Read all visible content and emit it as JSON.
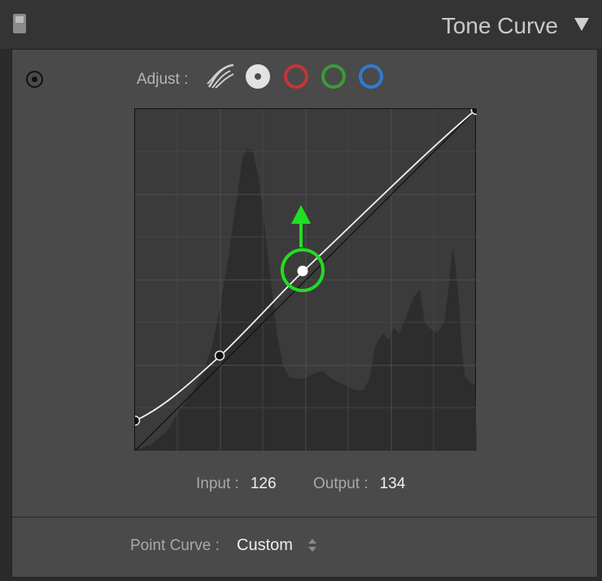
{
  "header": {
    "title": "Tone Curve",
    "panel_toggle_icon": "panel-switch-icon",
    "collapse_icon": "triangle-down-icon"
  },
  "adjust": {
    "label": "Adjust :",
    "channels": [
      {
        "name": "region",
        "icon": "region-curve-icon"
      },
      {
        "name": "point",
        "icon": "point-curve-icon",
        "selected": true
      },
      {
        "name": "red",
        "color": "#c4343a"
      },
      {
        "name": "green",
        "color": "#3a9a3a"
      },
      {
        "name": "blue",
        "color": "#2f7bd3"
      }
    ]
  },
  "curve": {
    "control_points": [
      [
        0,
        22
      ],
      [
        63,
        77
      ],
      [
        126,
        134
      ],
      [
        255,
        255
      ]
    ],
    "active_point_input": 126,
    "indicator_color": "#22dd22"
  },
  "readout": {
    "input_label": "Input :",
    "input_value": "126",
    "output_label": "Output :",
    "output_value": "134"
  },
  "point_curve": {
    "label": "Point Curve :",
    "value": "Custom"
  }
}
